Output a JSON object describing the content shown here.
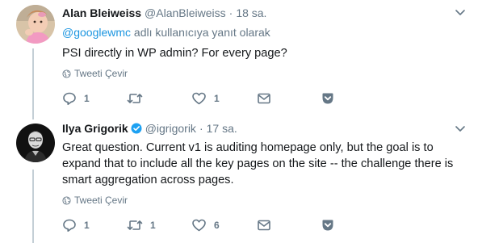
{
  "tweets": [
    {
      "name": "Alan Bleiweiss",
      "handle": "@AlanBleiweiss",
      "separator": "·",
      "time": "18 sa.",
      "reply_prefix": "",
      "reply_mention": "@googlewmc",
      "reply_suffix": " adlı kullanıcıya yanıt olarak",
      "text": "PSI directly in WP admin? For every page?",
      "translate": "Tweeti Çevir",
      "replies": "1",
      "retweets": "",
      "likes": "1",
      "verified": false
    },
    {
      "name": "Ilya Grigorik",
      "handle": "@igrigorik",
      "separator": "·",
      "time": "17 sa.",
      "text": "Great question. Current v1 is auditing homepage only, but the goal is to expand that to include all the key pages on the site -- the challenge there is smart aggregation across pages.",
      "translate": "Tweeti Çevir",
      "replies": "1",
      "retweets": "1",
      "likes": "6",
      "verified": true
    }
  ],
  "colors": {
    "text": "#14171a",
    "muted": "#657786",
    "link": "#1b95e0",
    "verified": "#1da1f2",
    "thread_line": "#c4cfd6"
  }
}
